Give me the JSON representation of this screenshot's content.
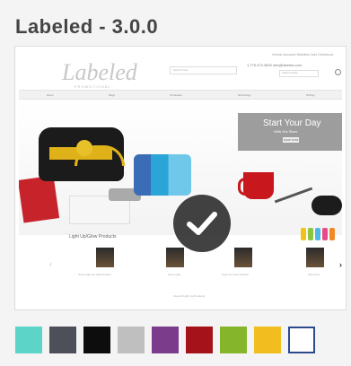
{
  "title": "Labeled - 3.0.0",
  "preview": {
    "logo_text": "Labeled",
    "logo_sub": "PROMOTIONAL",
    "topbar_links": "Home   Account   Wishlist   Cart   Checkout",
    "search_placeholder": "Search here",
    "phone": "1.775.473.3000   info@labeled.com",
    "search2_placeholder": "Search entire",
    "nav": [
      "Home",
      "Bags",
      "Drinkware",
      "Technology",
      "Writing"
    ],
    "hero": {
      "title": "Start Your Day",
      "subtitle": "With Our Store",
      "button": "SHOP NOW"
    },
    "products_title": "Light Up/Glow Products",
    "product_captions": [
      "Glow Light Up LED Product",
      "Glow Light",
      "Light Up Glow Product",
      "LED Glow"
    ],
    "footer_link": "View All Light Up Products"
  },
  "check_icon": "checkmark-icon",
  "swatches": [
    {
      "name": "turquoise",
      "color": "#5dd4c8",
      "selected": false
    },
    {
      "name": "charcoal",
      "color": "#4d5058",
      "selected": false
    },
    {
      "name": "black",
      "color": "#0d0d0d",
      "selected": false
    },
    {
      "name": "silver",
      "color": "#bfbfbf",
      "selected": false
    },
    {
      "name": "purple",
      "color": "#7c3c8c",
      "selected": false
    },
    {
      "name": "crimson",
      "color": "#a5121a",
      "selected": false
    },
    {
      "name": "green",
      "color": "#85b52a",
      "selected": false
    },
    {
      "name": "yellow",
      "color": "#f2be1f",
      "selected": false
    },
    {
      "name": "white",
      "color": "#ffffff",
      "selected": true
    }
  ]
}
